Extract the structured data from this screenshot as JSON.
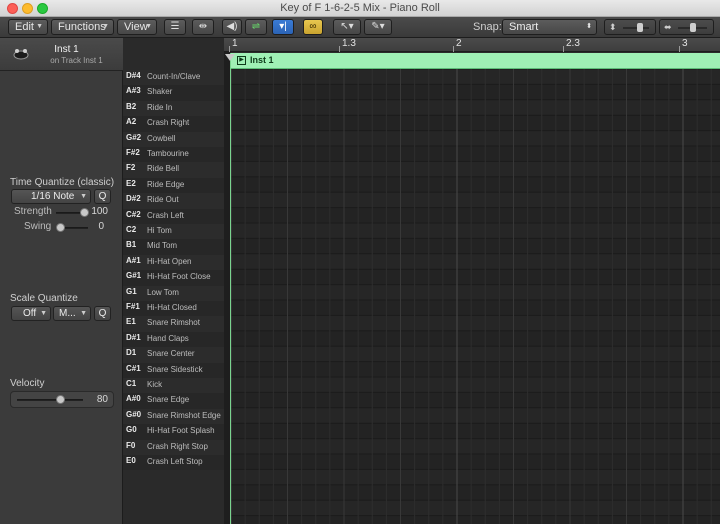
{
  "window": {
    "title": "Key of F 1-6-2-5 Mix - Piano Roll"
  },
  "toolbar": {
    "edit_label": "Edit",
    "functions_label": "Functions",
    "view_label": "View",
    "snap_label": "Snap:",
    "snap_value": "Smart"
  },
  "inspector": {
    "title": "Inst 1",
    "subtitle": "on Track Inst 1",
    "time_quantize": {
      "title": "Time Quantize (classic)",
      "value": "1/16 Note",
      "q_label": "Q",
      "strength_label": "Strength",
      "strength_value": "100",
      "swing_label": "Swing",
      "swing_value": "0"
    },
    "scale_quantize": {
      "title": "Scale Quantize",
      "mode_value": "Off",
      "scale_value": "M...",
      "q_label": "Q"
    },
    "velocity": {
      "title": "Velocity",
      "value": "80"
    }
  },
  "ruler": {
    "marks": [
      "1",
      "1.3",
      "2",
      "2.3",
      "3"
    ]
  },
  "region": {
    "name": "Inst 1"
  },
  "drum_map": [
    {
      "note": "D#4",
      "name": "Count-In/Clave"
    },
    {
      "note": "A#3",
      "name": "Shaker"
    },
    {
      "note": "B2",
      "name": "Ride In"
    },
    {
      "note": "A2",
      "name": "Crash Right"
    },
    {
      "note": "G#2",
      "name": "Cowbell"
    },
    {
      "note": "F#2",
      "name": "Tambourine"
    },
    {
      "note": "F2",
      "name": "Ride Bell"
    },
    {
      "note": "E2",
      "name": "Ride Edge"
    },
    {
      "note": "D#2",
      "name": "Ride Out"
    },
    {
      "note": "C#2",
      "name": "Crash Left"
    },
    {
      "note": "C2",
      "name": "Hi Tom"
    },
    {
      "note": "B1",
      "name": "Mid Tom"
    },
    {
      "note": "A#1",
      "name": "Hi-Hat Open"
    },
    {
      "note": "G#1",
      "name": "Hi-Hat Foot Close"
    },
    {
      "note": "G1",
      "name": "Low Tom"
    },
    {
      "note": "F#1",
      "name": "Hi-Hat Closed"
    },
    {
      "note": "E1",
      "name": "Snare Rimshot"
    },
    {
      "note": "D#1",
      "name": "Hand Claps"
    },
    {
      "note": "D1",
      "name": "Snare Center"
    },
    {
      "note": "C#1",
      "name": "Snare Sidestick"
    },
    {
      "note": "C1",
      "name": "Kick"
    },
    {
      "note": "A#0",
      "name": "Snare Edge"
    },
    {
      "note": "G#0",
      "name": "Snare Rimshot Edge"
    },
    {
      "note": "G0",
      "name": "Hi-Hat Foot Splash"
    },
    {
      "note": "F0",
      "name": "Crash Right Stop"
    },
    {
      "note": "E0",
      "name": "Crash Left Stop"
    }
  ],
  "icons": {
    "close": "close-dot",
    "minimize": "minimize-dot",
    "maximize": "maximize-dot"
  },
  "colors": {
    "region": "#9ff0b5",
    "playhead": "#7ad48f",
    "accent_blue": "#3a7bd5",
    "accent_yellow": "#e8c74f"
  }
}
